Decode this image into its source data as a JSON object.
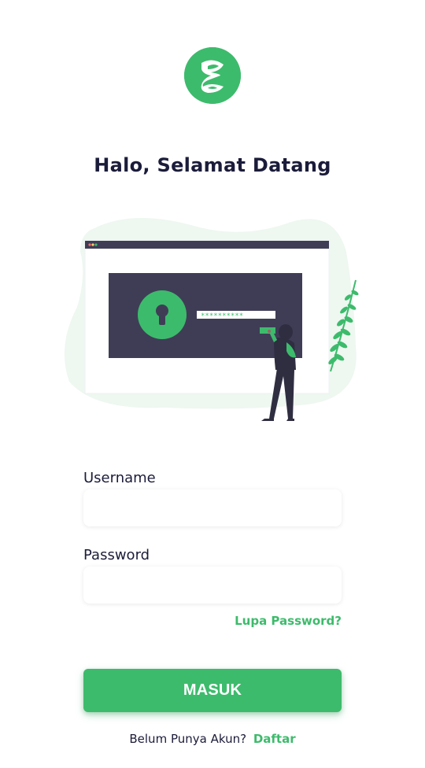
{
  "app": {
    "accent_color": "#3dbb6c",
    "text_color": "#1b1c3a"
  },
  "header": {
    "logo": "app-logo",
    "title": "Halo, Selamat Datang"
  },
  "illustration": {
    "name": "login-illustration",
    "password_mask": "**********"
  },
  "form": {
    "username_label": "Username",
    "username_value": "",
    "password_label": "Password",
    "password_value": "",
    "forgot_label": "Lupa Password?",
    "submit_label": "MASUK"
  },
  "footer": {
    "prompt": "Belum Punya Akun?",
    "link_label": "Daftar"
  }
}
